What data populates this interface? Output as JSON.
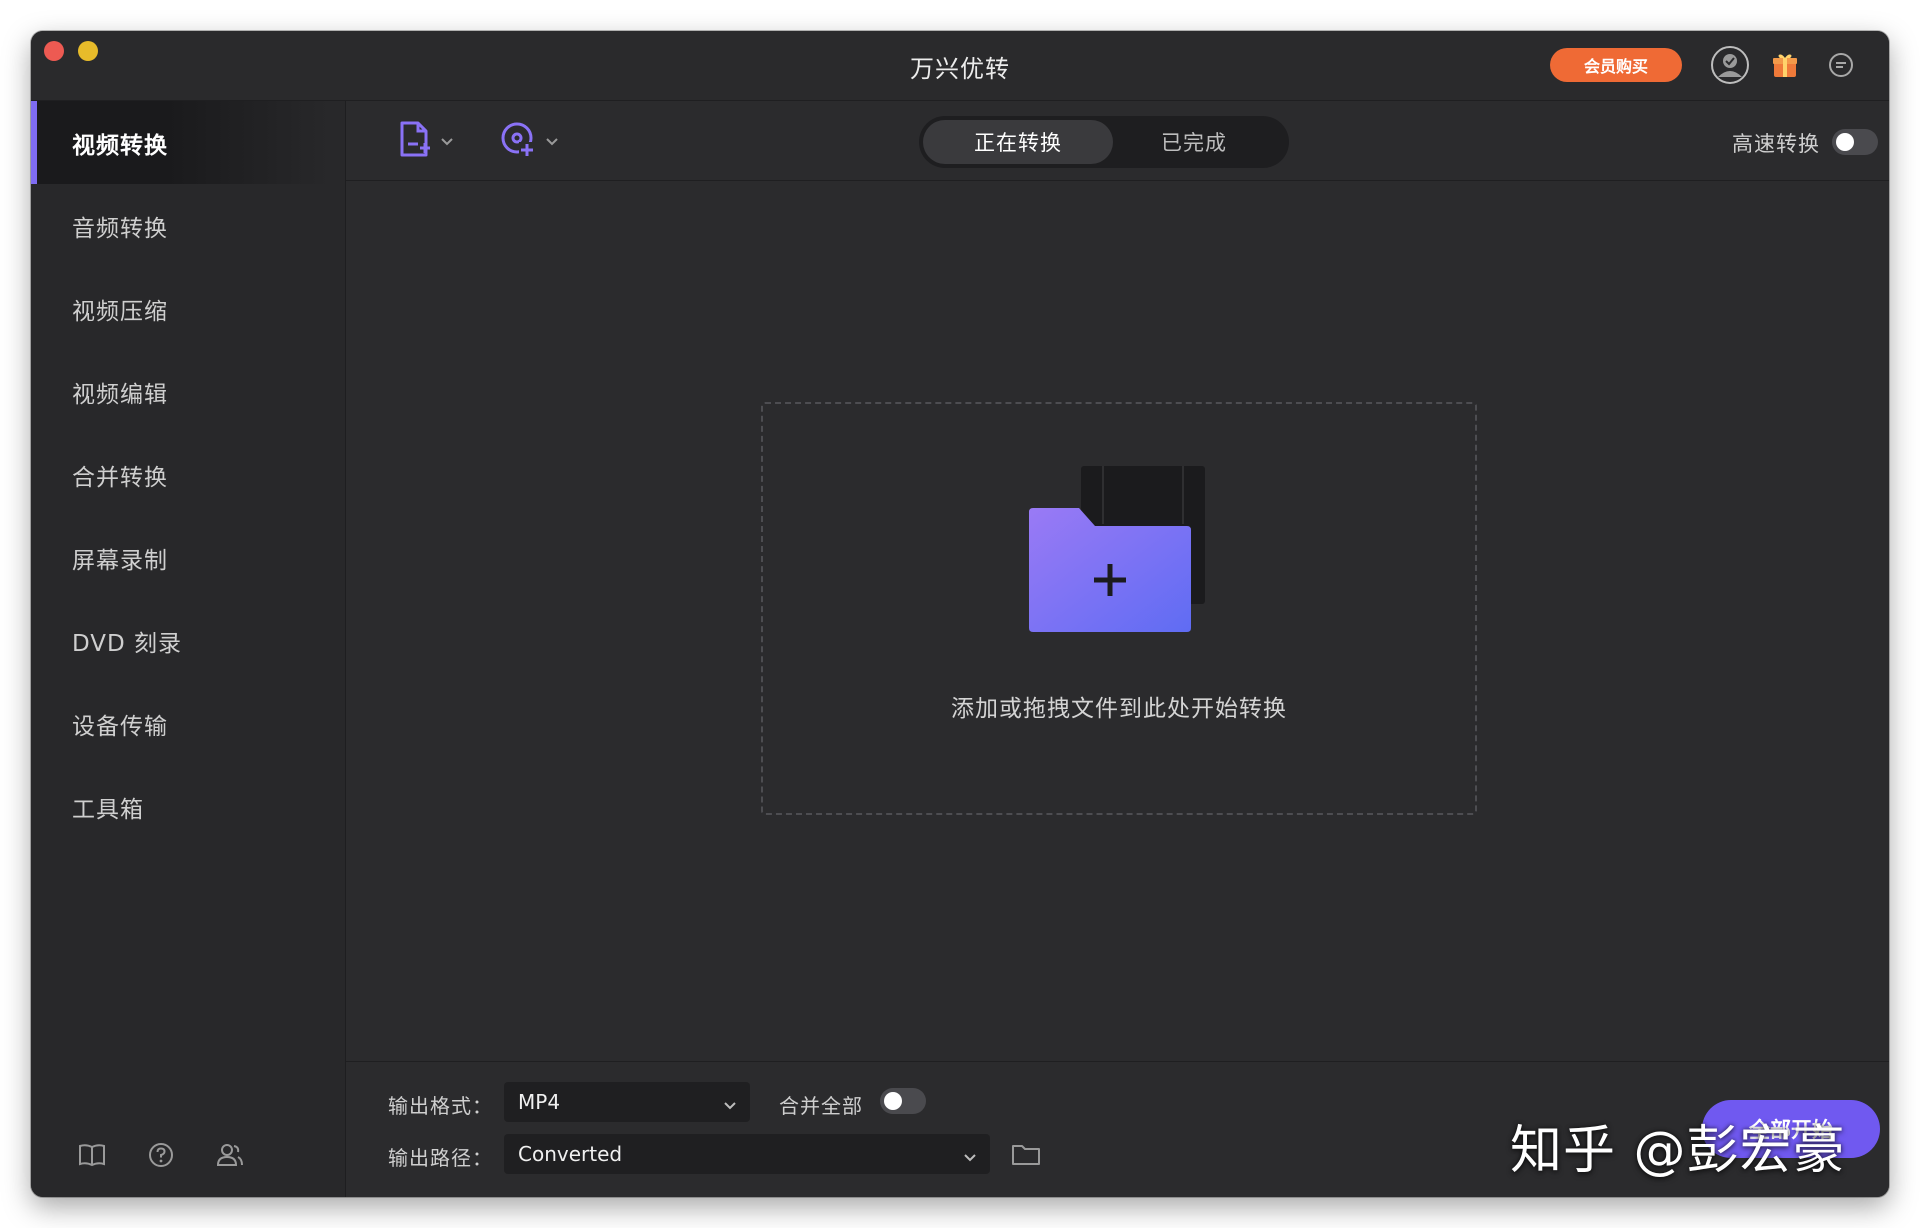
{
  "window": {
    "title": "万兴优转",
    "vip_button": "会员购买"
  },
  "sidebar": {
    "items": [
      {
        "label": "视频转换",
        "active": true
      },
      {
        "label": "音频转换"
      },
      {
        "label": "视频压缩"
      },
      {
        "label": "视频编辑"
      },
      {
        "label": "合并转换"
      },
      {
        "label": "屏幕录制"
      },
      {
        "label": "DVD 刻录"
      },
      {
        "label": "设备传输"
      },
      {
        "label": "工具箱"
      }
    ],
    "bottom_icons": [
      "book-icon",
      "help-icon",
      "user-group-icon"
    ]
  },
  "toolbar": {
    "tabs": [
      {
        "label": "正在转换",
        "active": true
      },
      {
        "label": "已完成"
      }
    ],
    "speed_label": "高速转换",
    "speed_enabled": false
  },
  "main": {
    "drop_text": "添加或拖拽文件到此处开始转换"
  },
  "footer": {
    "format_label": "输出格式：",
    "format_value": "MP4",
    "merge_label": "合并全部",
    "merge_enabled": false,
    "path_label": "输出路径：",
    "path_value": "Converted",
    "convert_all": "全部开始"
  },
  "watermark": "知乎 @彭宏豪",
  "colors": {
    "accent": "#7f6cf2",
    "vip": "#ef6a35",
    "background": "#2b2b2d"
  }
}
